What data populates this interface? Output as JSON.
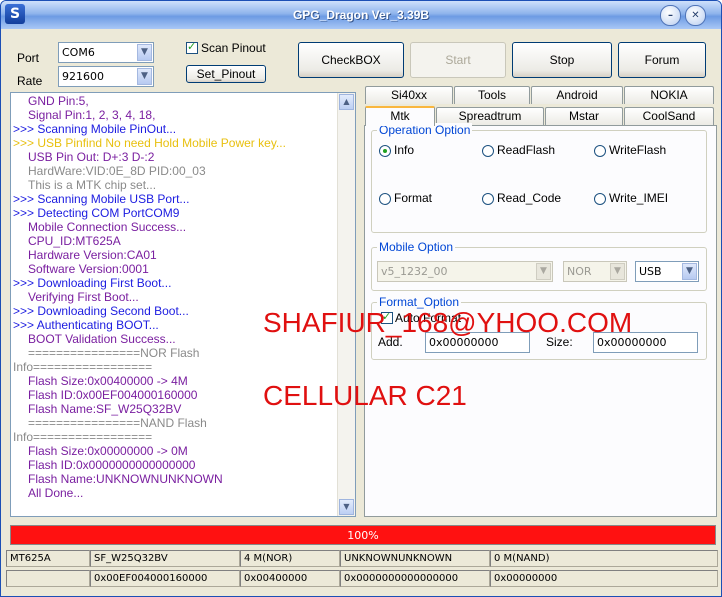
{
  "window": {
    "title": "GPG_Dragon  Ver_3.39B",
    "icon_letter": "S"
  },
  "port": {
    "label": "Port",
    "value": "COM6"
  },
  "rate": {
    "label": "Rate",
    "value": "921600"
  },
  "scan_pinout": {
    "label": "Scan Pinout",
    "checked": true
  },
  "set_pinout_label": "Set_Pinout",
  "buttons": {
    "checkbox": "CheckBOX",
    "start": "Start",
    "stop": "Stop",
    "forum": "Forum"
  },
  "colors": {
    "log_blue": "#1c1ce0",
    "log_purple": "#7a1fa0",
    "log_gray": "#8a8a8a",
    "log_yellow": "#e8c010",
    "progress": "#ff1111",
    "group_title": "#0046d5"
  },
  "log_lines": [
    {
      "text": "GND Pin:5,",
      "indent": 1,
      "color": "#7a1fa0"
    },
    {
      "text": "Signal Pin:1, 2, 3, 4, 18,",
      "indent": 1,
      "color": "#7a1fa0"
    },
    {
      "text": ">>> Scanning Mobile PinOut...",
      "indent": 0,
      "color": "#1c1ce0"
    },
    {
      "text": ">>> USB Pinfind No need Hold Mobile Power key...",
      "indent": 0,
      "color": "#e8c010"
    },
    {
      "text": "USB Pin Out: D+:3  D-:2",
      "indent": 1,
      "color": "#7a1fa0"
    },
    {
      "text": "HardWare:VID:0E_8D PID:00_03",
      "indent": 1,
      "color": "#8a8a8a"
    },
    {
      "text": "This is a MTK chip set...",
      "indent": 1,
      "color": "#8a8a8a"
    },
    {
      "text": ">>> Scanning Mobile USB Port...",
      "indent": 0,
      "color": "#1c1ce0"
    },
    {
      "text": ">>> Detecting COM PortCOM9",
      "indent": 0,
      "color": "#1c1ce0"
    },
    {
      "text": "Mobile Connection Success...",
      "indent": 1,
      "color": "#7a1fa0"
    },
    {
      "text": "CPU_ID:MT625A",
      "indent": 1,
      "color": "#7a1fa0"
    },
    {
      "text": "Hardware Version:CA01",
      "indent": 1,
      "color": "#7a1fa0"
    },
    {
      "text": "Software Version:0001",
      "indent": 1,
      "color": "#7a1fa0"
    },
    {
      "text": ">>> Downloading First Boot...",
      "indent": 0,
      "color": "#1c1ce0"
    },
    {
      "text": "Verifying First Boot...",
      "indent": 1,
      "color": "#7a1fa0"
    },
    {
      "text": ">>> Downloading Second Boot...",
      "indent": 0,
      "color": "#1c1ce0"
    },
    {
      "text": ">>> Authenticating BOOT...",
      "indent": 0,
      "color": "#1c1ce0"
    },
    {
      "text": "BOOT Validation Success...",
      "indent": 1,
      "color": "#7a1fa0"
    },
    {
      "text": "================NOR Flash",
      "indent": 1,
      "color": "#8a8a8a"
    },
    {
      "text": "Info=================",
      "indent": 0,
      "color": "#8a8a8a"
    },
    {
      "text": "Flash Size:0x00400000 -> 4M",
      "indent": 1,
      "color": "#7a1fa0"
    },
    {
      "text": "Flash ID:0x00EF004000160000",
      "indent": 1,
      "color": "#7a1fa0"
    },
    {
      "text": "Flash Name:SF_W25Q32BV",
      "indent": 1,
      "color": "#7a1fa0"
    },
    {
      "text": "================NAND Flash",
      "indent": 1,
      "color": "#8a8a8a"
    },
    {
      "text": "Info=================",
      "indent": 0,
      "color": "#8a8a8a"
    },
    {
      "text": "Flash Size:0x00000000 -> 0M",
      "indent": 1,
      "color": "#7a1fa0"
    },
    {
      "text": "Flash ID:0x0000000000000000",
      "indent": 1,
      "color": "#7a1fa0"
    },
    {
      "text": "Flash Name:UNKNOWNUNKNOWN",
      "indent": 1,
      "color": "#7a1fa0"
    },
    {
      "text": "All Done...",
      "indent": 1,
      "color": "#7a1fa0"
    }
  ],
  "tabs_row1": [
    "Si40xx",
    "Tools",
    "Android",
    "NOKIA"
  ],
  "tabs_row2": [
    "Mtk",
    "Spreadtrum",
    "Mstar",
    "CoolSand"
  ],
  "active_tab": "Mtk",
  "operation_option": {
    "title": "Operation Option",
    "options": [
      "Info",
      "ReadFlash",
      "WriteFlash",
      "Format",
      "Read_Code",
      "Write_IMEI"
    ],
    "selected": "Info"
  },
  "mobile_option": {
    "title": "Mobile Option",
    "model": "v5_1232_00",
    "flash": "NOR",
    "connection": "USB"
  },
  "format_option": {
    "title": "Format_Option",
    "auto_format_label": "Auto Format",
    "auto_format_checked": true,
    "add_label": "Add.",
    "add_value": "0x00000000",
    "size_label": "Size:",
    "size_value": "0x00000000"
  },
  "progress": {
    "percent": 100,
    "text": "100%"
  },
  "status_row1": [
    "MT625A",
    "SF_W25Q32BV",
    "4 M(NOR)",
    "UNKNOWNUNKNOWN",
    "0 M(NAND)"
  ],
  "status_row2": [
    "",
    "0x00EF004000160000",
    "0x00400000",
    "0x0000000000000000",
    "0x00000000"
  ],
  "overlay": {
    "line1": "SHAFIUR_168@YHOO.COM",
    "line2": "CELLULAR C21"
  }
}
